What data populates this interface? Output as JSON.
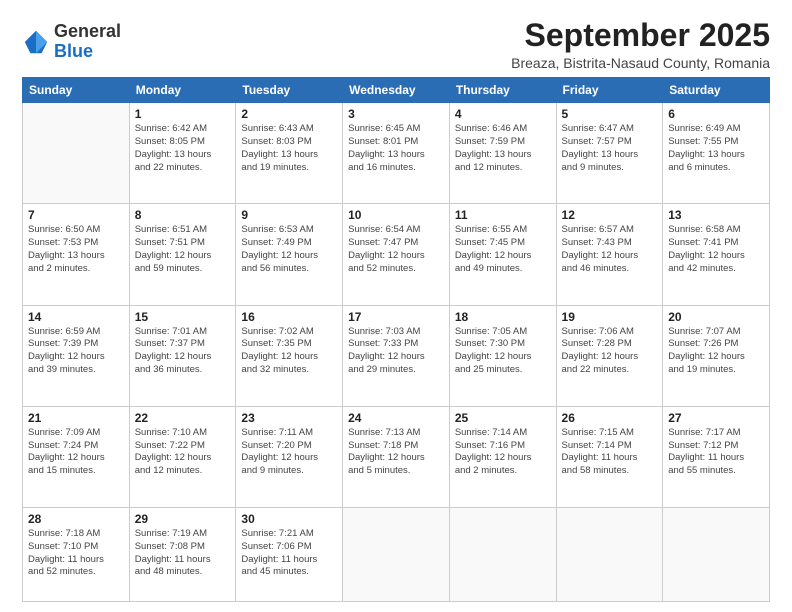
{
  "logo": {
    "general": "General",
    "blue": "Blue"
  },
  "title": "September 2025",
  "location": "Breaza, Bistrita-Nasaud County, Romania",
  "days": [
    "Sunday",
    "Monday",
    "Tuesday",
    "Wednesday",
    "Thursday",
    "Friday",
    "Saturday"
  ],
  "weeks": [
    [
      {
        "date": "",
        "info": ""
      },
      {
        "date": "1",
        "info": "Sunrise: 6:42 AM\nSunset: 8:05 PM\nDaylight: 13 hours\nand 22 minutes."
      },
      {
        "date": "2",
        "info": "Sunrise: 6:43 AM\nSunset: 8:03 PM\nDaylight: 13 hours\nand 19 minutes."
      },
      {
        "date": "3",
        "info": "Sunrise: 6:45 AM\nSunset: 8:01 PM\nDaylight: 13 hours\nand 16 minutes."
      },
      {
        "date": "4",
        "info": "Sunrise: 6:46 AM\nSunset: 7:59 PM\nDaylight: 13 hours\nand 12 minutes."
      },
      {
        "date": "5",
        "info": "Sunrise: 6:47 AM\nSunset: 7:57 PM\nDaylight: 13 hours\nand 9 minutes."
      },
      {
        "date": "6",
        "info": "Sunrise: 6:49 AM\nSunset: 7:55 PM\nDaylight: 13 hours\nand 6 minutes."
      }
    ],
    [
      {
        "date": "7",
        "info": "Sunrise: 6:50 AM\nSunset: 7:53 PM\nDaylight: 13 hours\nand 2 minutes."
      },
      {
        "date": "8",
        "info": "Sunrise: 6:51 AM\nSunset: 7:51 PM\nDaylight: 12 hours\nand 59 minutes."
      },
      {
        "date": "9",
        "info": "Sunrise: 6:53 AM\nSunset: 7:49 PM\nDaylight: 12 hours\nand 56 minutes."
      },
      {
        "date": "10",
        "info": "Sunrise: 6:54 AM\nSunset: 7:47 PM\nDaylight: 12 hours\nand 52 minutes."
      },
      {
        "date": "11",
        "info": "Sunrise: 6:55 AM\nSunset: 7:45 PM\nDaylight: 12 hours\nand 49 minutes."
      },
      {
        "date": "12",
        "info": "Sunrise: 6:57 AM\nSunset: 7:43 PM\nDaylight: 12 hours\nand 46 minutes."
      },
      {
        "date": "13",
        "info": "Sunrise: 6:58 AM\nSunset: 7:41 PM\nDaylight: 12 hours\nand 42 minutes."
      }
    ],
    [
      {
        "date": "14",
        "info": "Sunrise: 6:59 AM\nSunset: 7:39 PM\nDaylight: 12 hours\nand 39 minutes."
      },
      {
        "date": "15",
        "info": "Sunrise: 7:01 AM\nSunset: 7:37 PM\nDaylight: 12 hours\nand 36 minutes."
      },
      {
        "date": "16",
        "info": "Sunrise: 7:02 AM\nSunset: 7:35 PM\nDaylight: 12 hours\nand 32 minutes."
      },
      {
        "date": "17",
        "info": "Sunrise: 7:03 AM\nSunset: 7:33 PM\nDaylight: 12 hours\nand 29 minutes."
      },
      {
        "date": "18",
        "info": "Sunrise: 7:05 AM\nSunset: 7:30 PM\nDaylight: 12 hours\nand 25 minutes."
      },
      {
        "date": "19",
        "info": "Sunrise: 7:06 AM\nSunset: 7:28 PM\nDaylight: 12 hours\nand 22 minutes."
      },
      {
        "date": "20",
        "info": "Sunrise: 7:07 AM\nSunset: 7:26 PM\nDaylight: 12 hours\nand 19 minutes."
      }
    ],
    [
      {
        "date": "21",
        "info": "Sunrise: 7:09 AM\nSunset: 7:24 PM\nDaylight: 12 hours\nand 15 minutes."
      },
      {
        "date": "22",
        "info": "Sunrise: 7:10 AM\nSunset: 7:22 PM\nDaylight: 12 hours\nand 12 minutes."
      },
      {
        "date": "23",
        "info": "Sunrise: 7:11 AM\nSunset: 7:20 PM\nDaylight: 12 hours\nand 9 minutes."
      },
      {
        "date": "24",
        "info": "Sunrise: 7:13 AM\nSunset: 7:18 PM\nDaylight: 12 hours\nand 5 minutes."
      },
      {
        "date": "25",
        "info": "Sunrise: 7:14 AM\nSunset: 7:16 PM\nDaylight: 12 hours\nand 2 minutes."
      },
      {
        "date": "26",
        "info": "Sunrise: 7:15 AM\nSunset: 7:14 PM\nDaylight: 11 hours\nand 58 minutes."
      },
      {
        "date": "27",
        "info": "Sunrise: 7:17 AM\nSunset: 7:12 PM\nDaylight: 11 hours\nand 55 minutes."
      }
    ],
    [
      {
        "date": "28",
        "info": "Sunrise: 7:18 AM\nSunset: 7:10 PM\nDaylight: 11 hours\nand 52 minutes."
      },
      {
        "date": "29",
        "info": "Sunrise: 7:19 AM\nSunset: 7:08 PM\nDaylight: 11 hours\nand 48 minutes."
      },
      {
        "date": "30",
        "info": "Sunrise: 7:21 AM\nSunset: 7:06 PM\nDaylight: 11 hours\nand 45 minutes."
      },
      {
        "date": "",
        "info": ""
      },
      {
        "date": "",
        "info": ""
      },
      {
        "date": "",
        "info": ""
      },
      {
        "date": "",
        "info": ""
      }
    ]
  ]
}
